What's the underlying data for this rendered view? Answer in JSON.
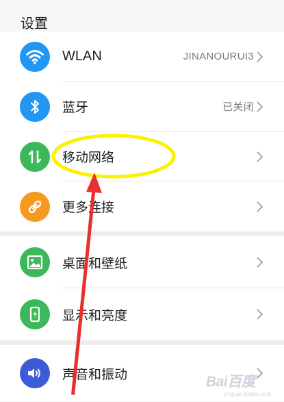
{
  "header": {
    "title": "设置"
  },
  "colors": {
    "wlan": "#2196f3",
    "bluetooth": "#2196f3",
    "mobile": "#3cb85a",
    "more": "#f59a1f",
    "wallpaper": "#3cb85a",
    "display": "#3cb85a",
    "sound": "#3b5bd9",
    "annotation": "#e8312f",
    "highlight": "#fdf000"
  },
  "sections": [
    {
      "items": [
        {
          "label": "WLAN",
          "value": "JINANOURUI3",
          "icon": "wifi-icon"
        },
        {
          "label": "蓝牙",
          "value": "已关闭",
          "icon": "bluetooth-icon"
        },
        {
          "label": "移动网络",
          "value": "",
          "icon": "mobile-data-icon"
        },
        {
          "label": "更多连接",
          "value": "",
          "icon": "link-icon"
        }
      ]
    },
    {
      "items": [
        {
          "label": "桌面和壁纸",
          "value": "",
          "icon": "wallpaper-icon"
        },
        {
          "label": "显示和亮度",
          "value": "",
          "icon": "brightness-icon"
        }
      ]
    },
    {
      "items": [
        {
          "label": "声音和振动",
          "value": "",
          "icon": "speaker-icon"
        }
      ]
    }
  ],
  "watermark": {
    "text": "Bai百度",
    "subtext": "jingyan.baidu.com"
  }
}
